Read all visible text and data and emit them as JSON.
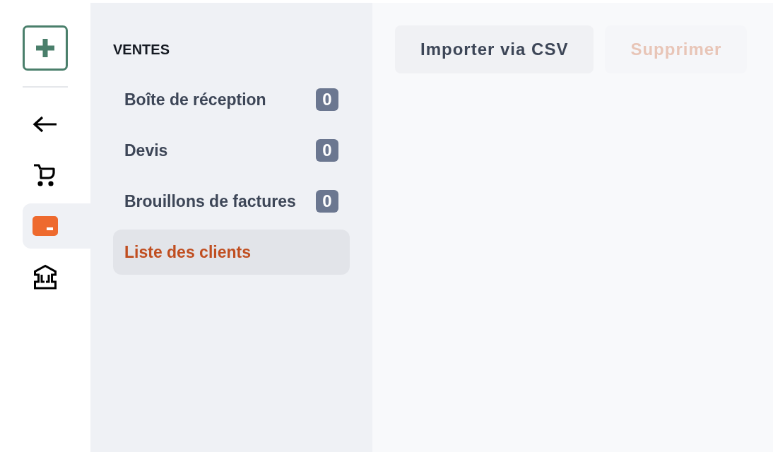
{
  "nav_rail": {
    "items": [
      {
        "kind": "create",
        "selected": false
      },
      {
        "kind": "back",
        "selected": false
      },
      {
        "kind": "cart",
        "selected": false
      },
      {
        "kind": "card",
        "selected": true
      },
      {
        "kind": "bank",
        "selected": false
      }
    ]
  },
  "sidebar": {
    "title": "VENTES",
    "items": [
      {
        "label": "Boîte de réception",
        "count": "0",
        "selected": false
      },
      {
        "label": "Devis",
        "count": "0",
        "selected": false
      },
      {
        "label": "Brouillons de factures",
        "count": "0",
        "selected": false
      },
      {
        "label": "Liste des clients",
        "selected": true
      }
    ]
  },
  "toolbar": {
    "buttons": [
      {
        "label": "Importer via CSV",
        "kind": "neutral",
        "disabled": false
      },
      {
        "label": "Supprimer",
        "kind": "danger",
        "disabled": true
      }
    ]
  }
}
